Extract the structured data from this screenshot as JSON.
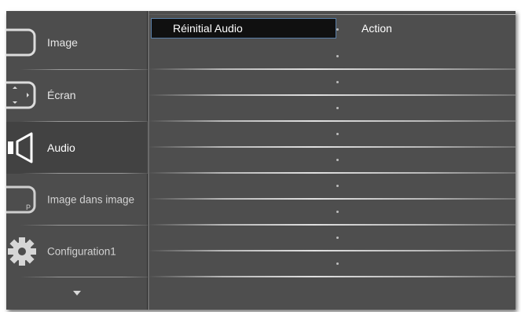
{
  "sidebar": {
    "items": [
      {
        "label": "Image",
        "icon": "monitor-icon"
      },
      {
        "label": "Écran",
        "icon": "screen-adjust-icon"
      },
      {
        "label": "Audio",
        "icon": "speaker-icon"
      },
      {
        "label": "Image dans image",
        "icon": "pip-icon"
      },
      {
        "label": "Configuration1",
        "icon": "gear-icon"
      }
    ],
    "selected": "Audio",
    "scroll_down_icon": "triangle-down-icon"
  },
  "main": {
    "selected_item": "Réinitial Audio",
    "selected_value": "Action"
  },
  "colors": {
    "background": "#4e4e4e",
    "selection_bg": "#101010",
    "selection_border": "#5a7fa8",
    "text": "#ffffff"
  }
}
